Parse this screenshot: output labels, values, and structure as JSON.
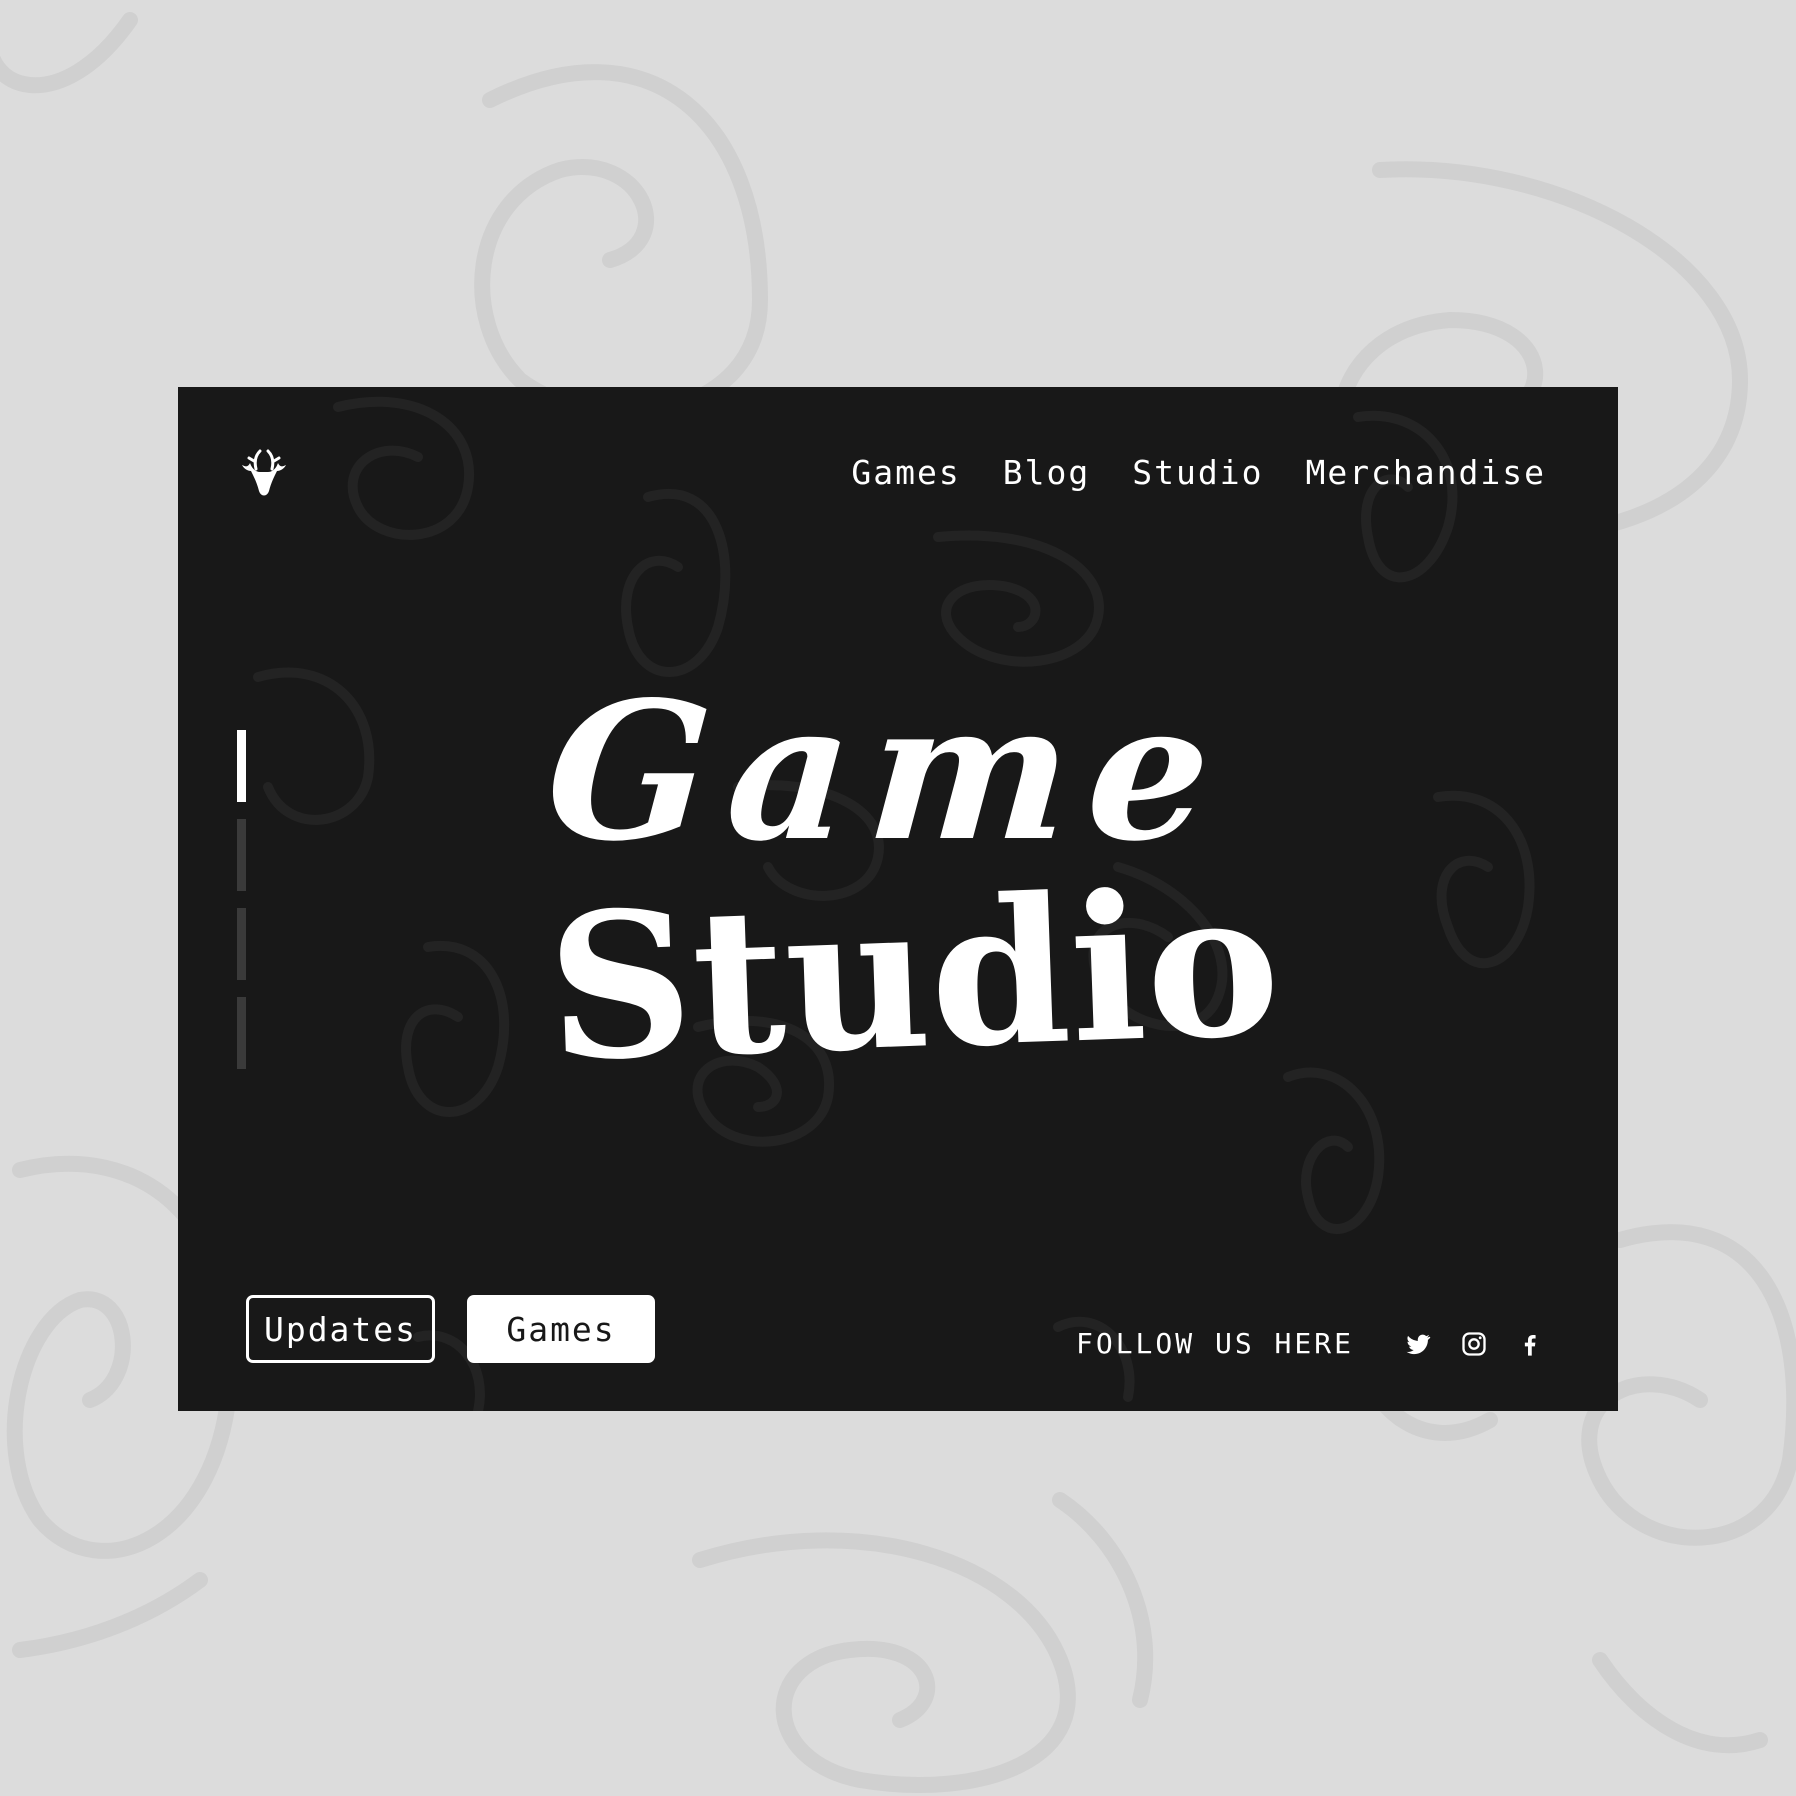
{
  "colors": {
    "background": "#dcdcdc",
    "card": "#181818",
    "foreground": "#ffffff",
    "progress_inactive": "#3a3a3a"
  },
  "brand": {
    "logo_icon": "deer-head-icon"
  },
  "nav": {
    "items": [
      {
        "label": "Games"
      },
      {
        "label": "Blog"
      },
      {
        "label": "Studio"
      },
      {
        "label": "Merchandise"
      }
    ]
  },
  "hero": {
    "line1": "Game",
    "line2": "Studio"
  },
  "slider": {
    "slides": 4,
    "active_index": 0
  },
  "buttons": {
    "updates_label": "Updates",
    "games_label": "Games"
  },
  "social": {
    "label": "FOLLOW US HERE",
    "icons": [
      "twitter-icon",
      "instagram-icon",
      "facebook-icon"
    ]
  }
}
